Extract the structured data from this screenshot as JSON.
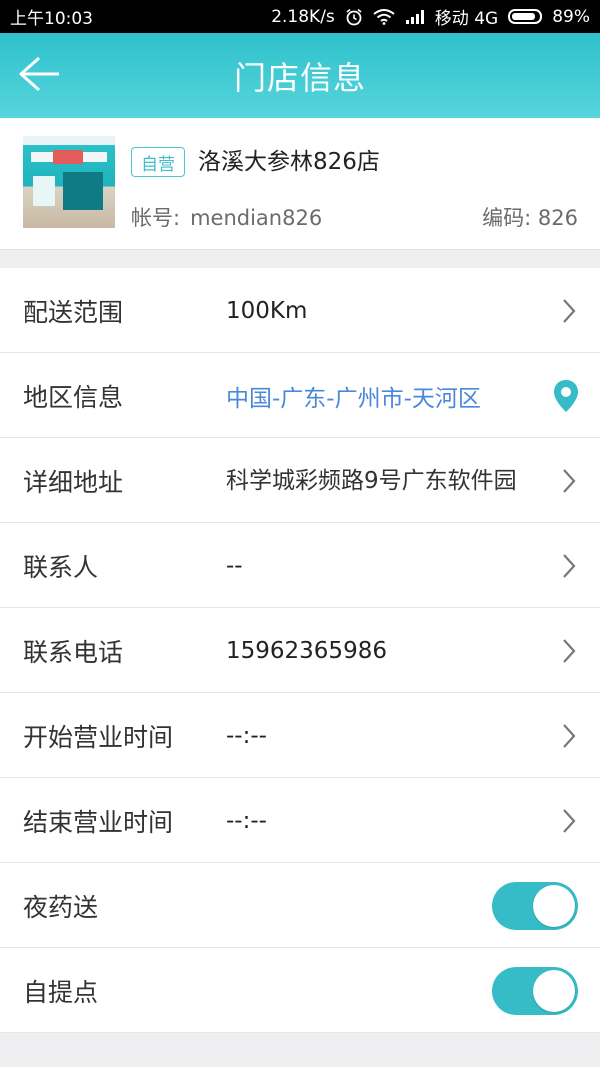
{
  "status_bar": {
    "time": "上午10:03",
    "speed": "2.18K/s",
    "carrier": "移动 4G",
    "battery": "89%",
    "battery_level": 0.89
  },
  "header": {
    "title": "门店信息",
    "back_icon": "arrow-left-icon"
  },
  "store": {
    "tag": "自营",
    "name": "洛溪大参林826店",
    "account_label": "帐号:",
    "account_value": "mendian826",
    "code": "编码: 826"
  },
  "rows": [
    {
      "label": "配送范围",
      "value": "100Km",
      "action": "chevron-right-icon"
    },
    {
      "label": "地区信息",
      "value": "中国-广东-广州市-天河区",
      "action": "location-pin-icon"
    },
    {
      "label": "详细地址",
      "value": "科学城彩频路9号广东软件园",
      "action": "chevron-right-icon"
    },
    {
      "label": "联系人",
      "value": "--",
      "action": "chevron-right-icon"
    },
    {
      "label": "联系电话",
      "value": "15962365986",
      "action": "chevron-right-icon"
    },
    {
      "label": "开始营业时间",
      "value": "--:--",
      "action": "chevron-right-icon"
    },
    {
      "label": "结束营业时间",
      "value": "--:--",
      "action": "chevron-right-icon"
    },
    {
      "label": "夜药送",
      "toggle": true
    },
    {
      "label": "自提点",
      "toggle": true
    }
  ],
  "colors": {
    "accent": "#35bcc6",
    "link": "#4a89d9",
    "header_gradient_top": "#2fc1cc",
    "header_gradient_bottom": "#56d5dc"
  }
}
